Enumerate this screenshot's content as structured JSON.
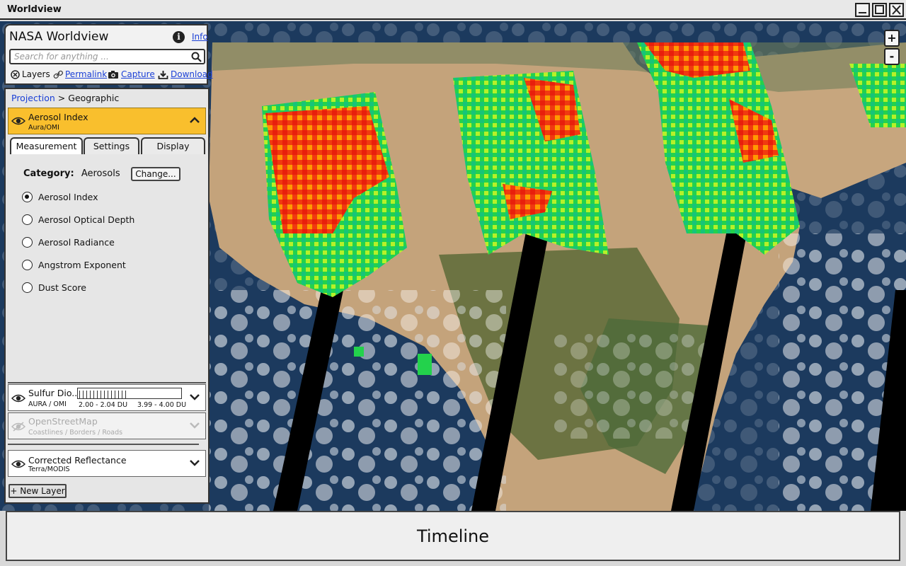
{
  "window": {
    "title": "Worldview"
  },
  "header": {
    "app_title": "NASA Worldview",
    "info_label": "Info",
    "search_placeholder": "Search for anything ...",
    "toolbar": {
      "layers": "Layers",
      "permalink": "Permalink",
      "capture": "Capture",
      "download": "Download"
    }
  },
  "projection": {
    "label": "Projection",
    "separator": ">",
    "value": "Geographic"
  },
  "active_layer": {
    "name": "Aerosol Index",
    "source": "Aura/OMI",
    "tabs": [
      {
        "label": "Measurement",
        "active": true
      },
      {
        "label": "Settings",
        "active": false
      },
      {
        "label": "Display",
        "active": false
      }
    ],
    "category_label": "Category:",
    "category_value": "Aerosols",
    "change_button": "Change...",
    "options": [
      {
        "label": "Aerosol Index",
        "selected": true
      },
      {
        "label": "Aerosol Optical Depth",
        "selected": false
      },
      {
        "label": "Aerosol Radiance",
        "selected": false
      },
      {
        "label": "Angstrom Exponent",
        "selected": false
      },
      {
        "label": "Dust Score",
        "selected": false
      }
    ]
  },
  "layers": [
    {
      "name": "Sulfur Dio..",
      "source": "AURA / OMI",
      "range_low": "2.00 - 2.04 DU",
      "range_high": "3.99 - 4.00 DU",
      "visible": true
    },
    {
      "name": "OpenStreetMap",
      "source": "Coastlines / Borders / Roads",
      "visible": false
    },
    {
      "name": "Corrected Reflectance",
      "source": "Terra/MODIS",
      "visible": true
    }
  ],
  "new_layer_button": "+ New Layer",
  "zoom": {
    "in": "+",
    "out": "-"
  },
  "timeline": {
    "label": "Timeline"
  },
  "colors": {
    "active_layer_bg": "#f9bf2d",
    "link": "#1a3fd6"
  }
}
